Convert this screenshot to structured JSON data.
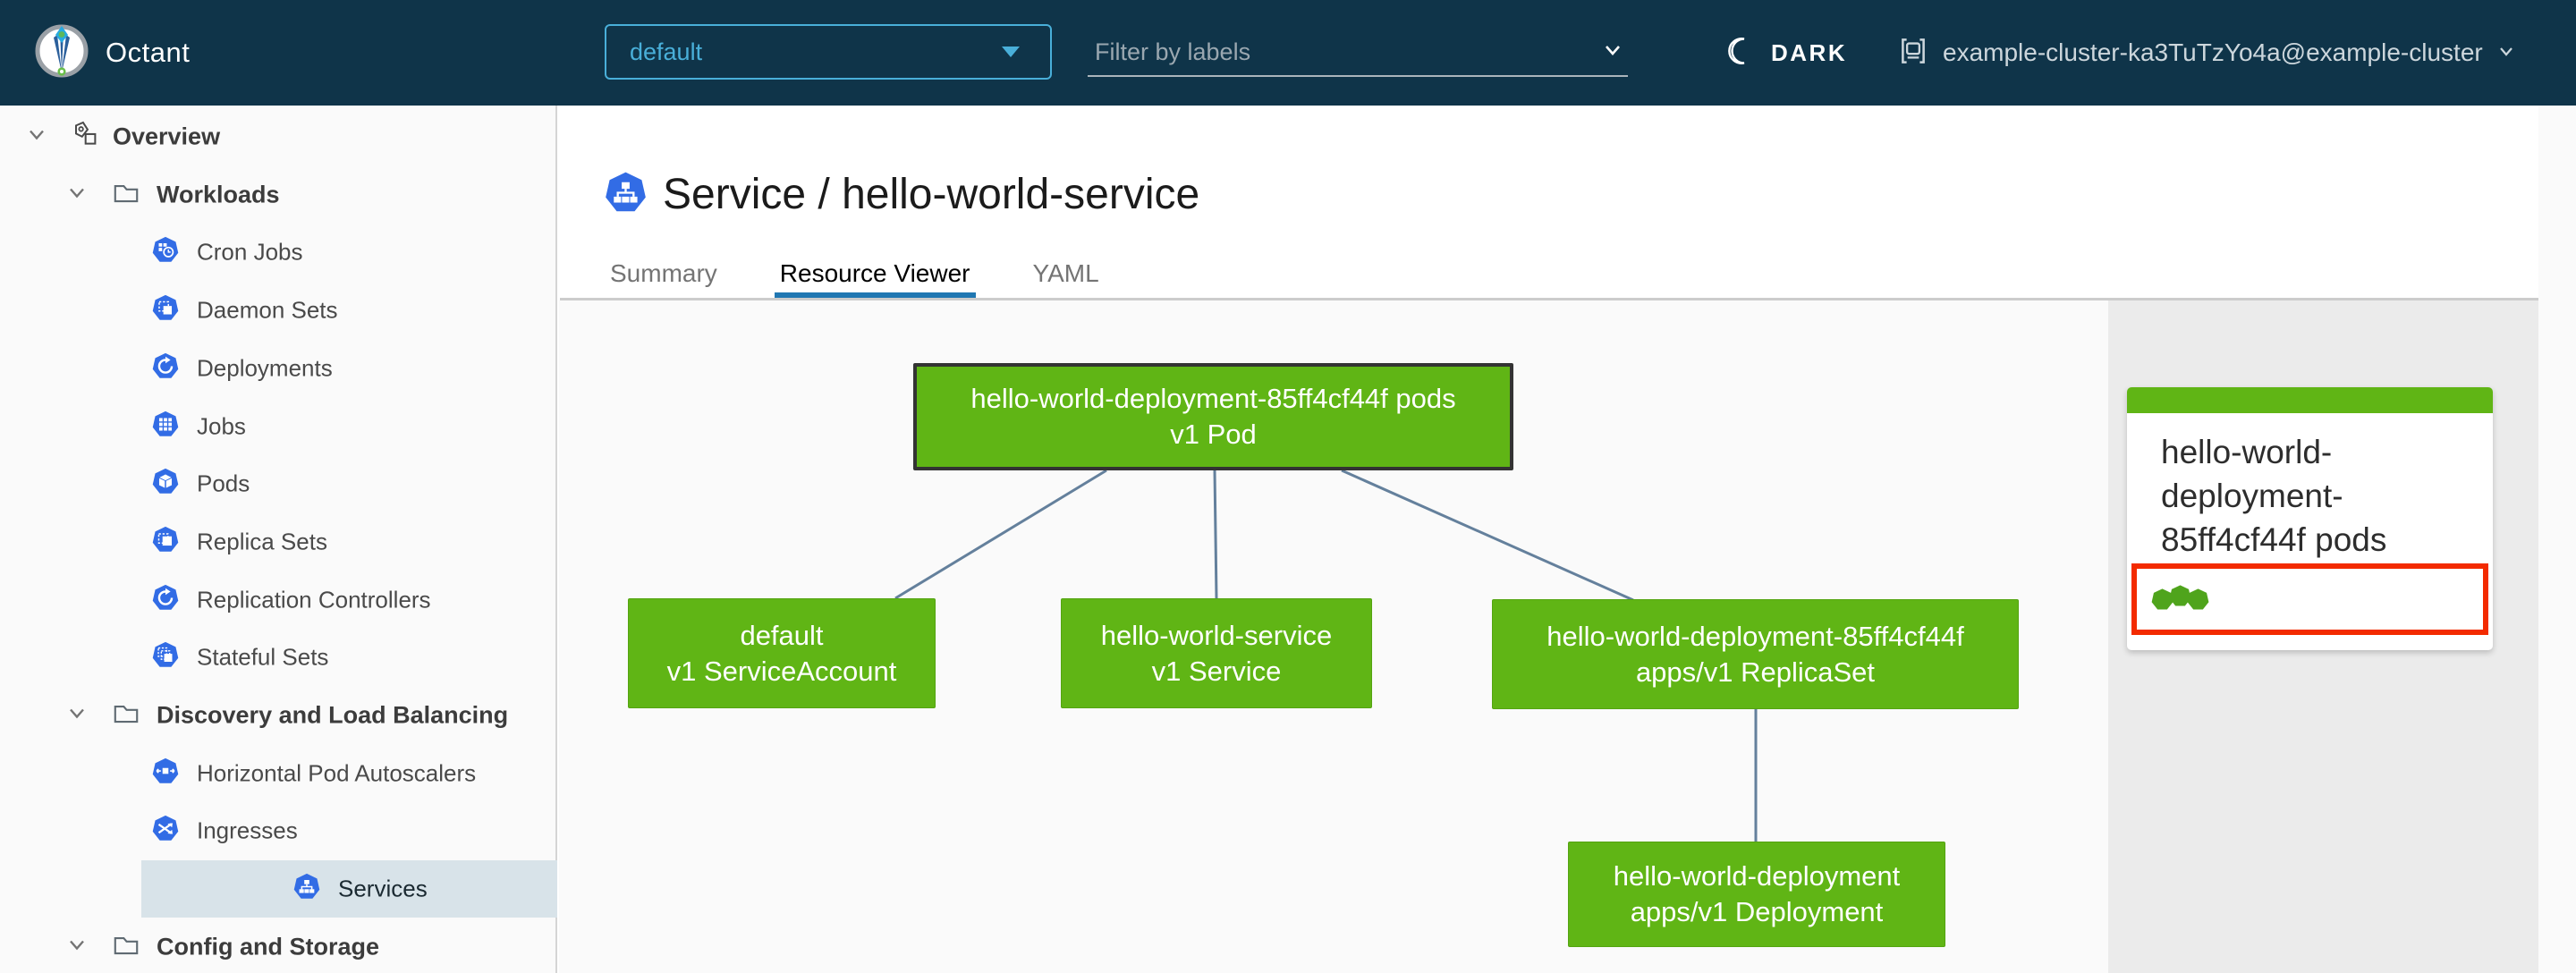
{
  "colors": {
    "header_bg": "#0f3449",
    "accent_blue": "#49afd9",
    "k8s_icon_blue": "#326ce5",
    "node_green": "#60b515",
    "status_dot_green": "#4fa41c",
    "highlight_red": "#f32b00",
    "tab_active_underline": "#2077b2",
    "selected_nav_bg": "#d8e3e9",
    "edge_blue": "#64809c"
  },
  "header": {
    "app_title": "Octant",
    "namespace_selector": {
      "value": "default",
      "icon": "chevron-down-icon"
    },
    "label_filter": {
      "placeholder": "Filter by labels",
      "icon": "chevron-down-icon"
    },
    "theme_toggle": {
      "label": "DARK",
      "icon": "moon-icon"
    },
    "context_selector": {
      "name": "example-cluster-ka3TuTzYo4a@example-cluster",
      "icon": "cluster-icon"
    }
  },
  "sidebar": {
    "items": [
      {
        "label": "Overview",
        "depth": 0,
        "icon": "applications-icon",
        "expandable": true,
        "expanded": true,
        "selected": false
      },
      {
        "label": "Workloads",
        "depth": 1,
        "icon": "folder-icon",
        "expandable": true,
        "expanded": true,
        "selected": false
      },
      {
        "label": "Cron Jobs",
        "depth": 2,
        "icon": "cronjob-icon",
        "selected": false
      },
      {
        "label": "Daemon Sets",
        "depth": 2,
        "icon": "daemonset-icon",
        "selected": false
      },
      {
        "label": "Deployments",
        "depth": 2,
        "icon": "deployment-icon",
        "selected": false
      },
      {
        "label": "Jobs",
        "depth": 2,
        "icon": "job-icon",
        "selected": false
      },
      {
        "label": "Pods",
        "depth": 2,
        "icon": "pod-icon",
        "selected": false
      },
      {
        "label": "Replica Sets",
        "depth": 2,
        "icon": "replicaset-icon",
        "selected": false
      },
      {
        "label": "Replication Controllers",
        "depth": 2,
        "icon": "replicationcontroller-icon",
        "selected": false
      },
      {
        "label": "Stateful Sets",
        "depth": 2,
        "icon": "statefulset-icon",
        "selected": false
      },
      {
        "label": "Discovery and Load Balancing",
        "depth": 1,
        "icon": "folder-icon",
        "expandable": true,
        "expanded": true,
        "selected": false
      },
      {
        "label": "Horizontal Pod Autoscalers",
        "depth": 2,
        "icon": "hpa-icon",
        "selected": false
      },
      {
        "label": "Ingresses",
        "depth": 2,
        "icon": "ingress-icon",
        "selected": false
      },
      {
        "label": "Services",
        "depth": 2,
        "icon": "service-icon",
        "selected": true
      },
      {
        "label": "Config and Storage",
        "depth": 1,
        "icon": "folder-icon",
        "expandable": true,
        "expanded": true,
        "selected": false
      }
    ]
  },
  "main": {
    "page_title": "Service / hello-world-service",
    "page_title_icon": "service-icon",
    "tabs": [
      {
        "label": "Summary",
        "active": false
      },
      {
        "label": "Resource Viewer",
        "active": true
      },
      {
        "label": "YAML",
        "active": false
      }
    ]
  },
  "graph": {
    "nodes": [
      {
        "id": "pod",
        "lines": [
          "hello-world-deployment-85ff4cf44f pods",
          "v1 Pod"
        ],
        "selected": true
      },
      {
        "id": "serviceaccount",
        "lines": [
          "default",
          "v1 ServiceAccount"
        ],
        "selected": false
      },
      {
        "id": "service",
        "lines": [
          "hello-world-service",
          "v1 Service"
        ],
        "selected": false
      },
      {
        "id": "replicaset",
        "lines": [
          "hello-world-deployment-85ff4cf44f",
          "apps/v1 ReplicaSet"
        ],
        "selected": false
      },
      {
        "id": "deployment",
        "lines": [
          "hello-world-deployment",
          "apps/v1 Deployment"
        ],
        "selected": false
      }
    ],
    "edges": [
      {
        "from": "pod",
        "to": "serviceaccount"
      },
      {
        "from": "pod",
        "to": "service"
      },
      {
        "from": "pod",
        "to": "replicaset"
      },
      {
        "from": "replicaset",
        "to": "deployment"
      }
    ]
  },
  "detail_card": {
    "title": "hello-world-deployment-85ff4cf44f pods",
    "pod_status": {
      "running_count": 3,
      "highlighted": true
    }
  }
}
